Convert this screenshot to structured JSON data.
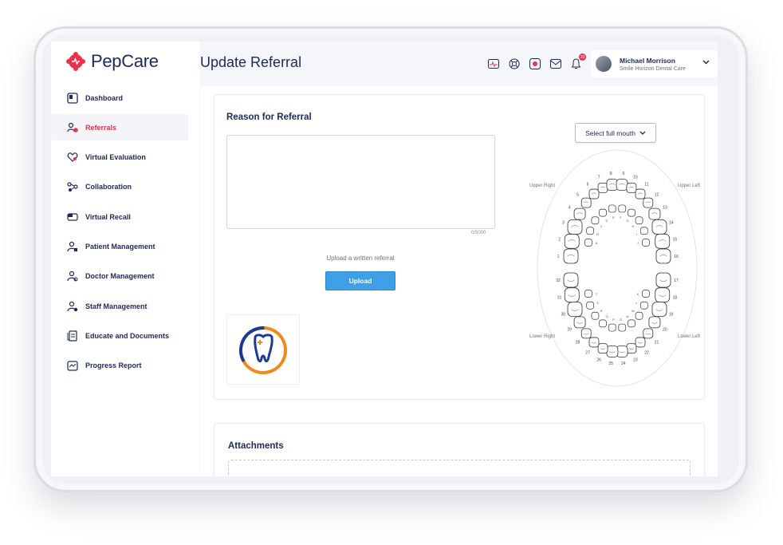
{
  "app": {
    "name": "PepCare",
    "accent": "#e8334a",
    "brand_navy": "#1e2a55"
  },
  "sidebar": {
    "items": [
      {
        "label": "Dashboard",
        "icon": "dashboard-icon",
        "active": false
      },
      {
        "label": "Referrals",
        "icon": "referrals-icon",
        "active": true
      },
      {
        "label": "Virtual Evaluation",
        "icon": "heart-chat-icon",
        "active": false
      },
      {
        "label": "Collaboration",
        "icon": "collaboration-icon",
        "active": false
      },
      {
        "label": "Virtual Recall",
        "icon": "recall-icon",
        "active": false
      },
      {
        "label": "Patient Management",
        "icon": "patient-icon",
        "active": false
      },
      {
        "label": "Doctor Management",
        "icon": "doctor-icon",
        "active": false
      },
      {
        "label": "Staff Management",
        "icon": "staff-icon",
        "active": false
      },
      {
        "label": "Educate and Documents",
        "icon": "document-icon",
        "active": false
      },
      {
        "label": "Progress Report",
        "icon": "progress-icon",
        "active": false
      }
    ]
  },
  "header": {
    "title": "Update Referral",
    "notification_count": "20",
    "user": {
      "name": "Michael Morrison",
      "org": "Smile Horizon Dental Care"
    }
  },
  "referral": {
    "section_title": "Reason for Referral",
    "reason_value": "",
    "char_count": "0/5000",
    "upload_hint": "Upload a written referral",
    "upload_label": "Upload",
    "select_label": "Select full mouth"
  },
  "tooth_chart": {
    "upper_right": "Upper Right",
    "upper_left": "Upper Left",
    "lower_right": "Lower Right",
    "lower_left": "Lower Left",
    "numbers": [
      "1",
      "2",
      "3",
      "4",
      "5",
      "6",
      "7",
      "8",
      "9",
      "10",
      "11",
      "12",
      "13",
      "14",
      "15",
      "16",
      "17",
      "18",
      "19",
      "20",
      "21",
      "22",
      "23",
      "24",
      "25",
      "26",
      "27",
      "28",
      "29",
      "30",
      "31",
      "32"
    ],
    "primary_letters": [
      "A",
      "B",
      "C",
      "D",
      "E",
      "F",
      "G",
      "H",
      "I",
      "J",
      "K",
      "L",
      "M",
      "N",
      "O",
      "P",
      "Q",
      "R",
      "S",
      "T"
    ]
  },
  "attachments": {
    "title": "Attachments"
  }
}
